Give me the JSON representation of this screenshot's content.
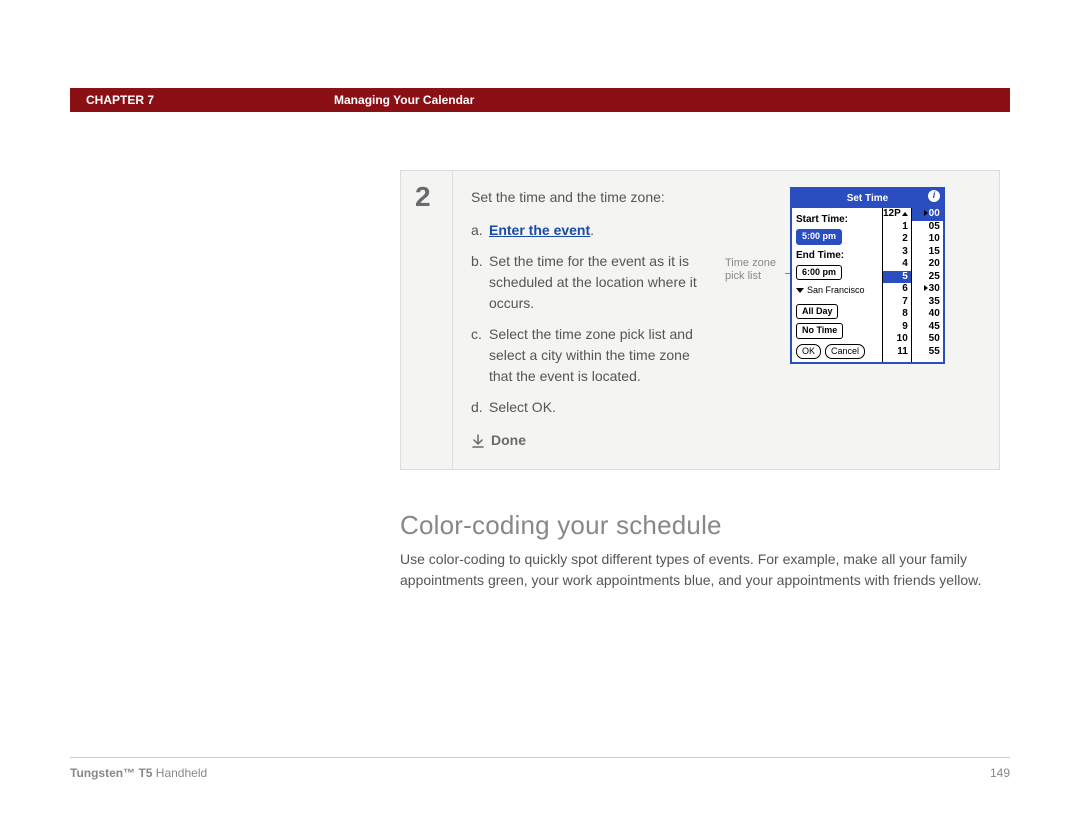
{
  "header": {
    "chapter": "CHAPTER 7",
    "title": "Managing Your Calendar"
  },
  "step": {
    "number": "2",
    "intro": "Set the time and the time zone:",
    "items": {
      "a": {
        "letter": "a.",
        "text": "Enter the event",
        "suffix": "."
      },
      "b": {
        "letter": "b.",
        "text": "Set the time for the event as it is scheduled at the location where it occurs."
      },
      "c": {
        "letter": "c.",
        "text": "Select the time zone pick list and select a city within the time zone that the event is located."
      },
      "d": {
        "letter": "d.",
        "text": "Select OK."
      }
    },
    "done": "Done"
  },
  "callout": {
    "line1": "Time zone",
    "line2": "pick list"
  },
  "device": {
    "title": "Set Time",
    "start_label": "Start Time:",
    "start_val": "5:00 pm",
    "end_label": "End Time:",
    "end_val": "6:00 pm",
    "tz_city": "San Francisco",
    "allday": "All Day",
    "notime": "No Time",
    "ok": "OK",
    "cancel": "Cancel",
    "hours": [
      "12P",
      "1",
      "2",
      "3",
      "4",
      "5",
      "6",
      "7",
      "8",
      "9",
      "10",
      "11"
    ],
    "selected_hour": "5",
    "minutes": [
      "00",
      "05",
      "10",
      "15",
      "20",
      "25",
      "30",
      "35",
      "40",
      "45",
      "50",
      "55"
    ],
    "minute_marker_rows": [
      "00",
      "30"
    ]
  },
  "section": {
    "heading": "Color-coding your schedule",
    "para": "Use color-coding to quickly spot different types of events. For example, make all your family appointments green, your work appointments blue, and your appointments with friends yellow."
  },
  "footer": {
    "product_bold": "Tungsten™ T5",
    "product_rest": " Handheld",
    "page": "149"
  }
}
